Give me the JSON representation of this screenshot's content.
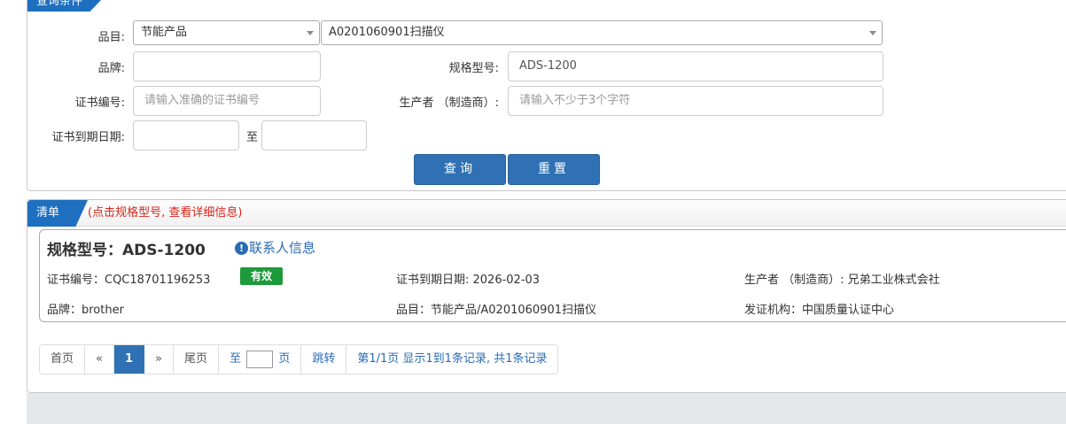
{
  "query": {
    "tab_label": "查询条件",
    "category_label": "品目:",
    "category_value": "节能产品",
    "subcategory_value": "A0201060901扫描仪",
    "brand_label": "品牌:",
    "brand_value": "",
    "model_label": "规格型号:",
    "model_value": "ADS-1200",
    "cert_no_label": "证书编号:",
    "cert_no_placeholder": "请输入准确的证书编号",
    "manufacturer_label": "生产者 （制造商）:",
    "manufacturer_placeholder": "请输入不少于3个字符",
    "expiry_label": "证书到期日期:",
    "expiry_to_label": "至",
    "search_button": "查询",
    "reset_button": "重置"
  },
  "list": {
    "tab_label": "清单",
    "hint": "(点击规格型号, 查看详细信息)",
    "results": [
      {
        "title": "规格型号：ADS-1200",
        "contact_label": "联系人信息",
        "cert_no": "证书编号：CQC18701196253",
        "status": "有效",
        "expiry": "证书到期日期: 2026-02-03",
        "manufacturer": "生产者 （制造商）: 兄弟工业株式会社",
        "brand": "品牌：brother",
        "category": "品目：节能产品/A0201060901扫描仪",
        "issuer": "发证机构：中国质量认证中心"
      }
    ]
  },
  "pagination": {
    "first": "首页",
    "prev": "«",
    "current": "1",
    "next": "»",
    "last": "尾页",
    "goto_prefix": "至",
    "goto_suffix": "页",
    "jump": "跳转",
    "summary": "第1/1页  显示1到1条记录, 共1条记录"
  }
}
